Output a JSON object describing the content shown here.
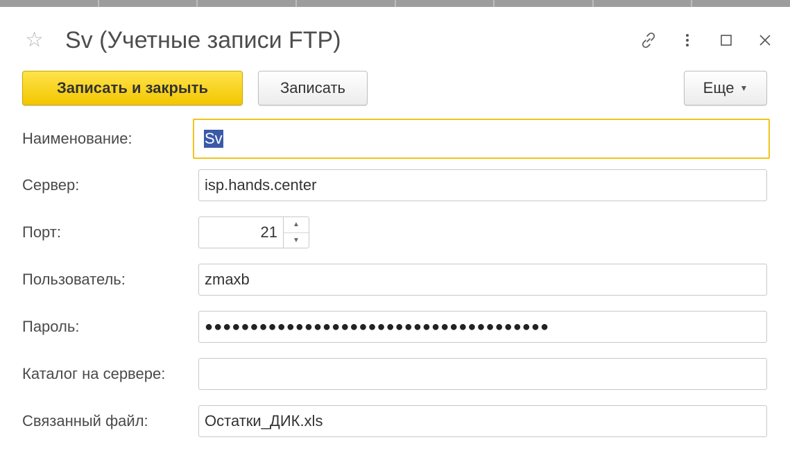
{
  "window": {
    "title": "Sv (Учетные записи FTP)",
    "icons": [
      "star-icon",
      "link-icon",
      "more-vert-icon",
      "maximize-icon",
      "close-icon"
    ]
  },
  "toolbar": {
    "save_close_label": "Записать и закрыть",
    "save_label": "Записать",
    "more_label": "Еще"
  },
  "form": {
    "name": {
      "label": "Наименование:",
      "value": "Sv"
    },
    "server": {
      "label": "Сервер:",
      "value": "isp.hands.center"
    },
    "port": {
      "label": "Порт:",
      "value": "21"
    },
    "user": {
      "label": "Пользователь:",
      "value": "zmaxb"
    },
    "password": {
      "label": "Пароль:",
      "value": "●●●●●●●●●●●●●●●●●●●●●●●●●●●●●●●●●●●●●●"
    },
    "directory": {
      "label": "Каталог на сервере:",
      "value": ""
    },
    "file": {
      "label": "Связанный файл:",
      "value": "Остатки_ДИК.xls"
    }
  },
  "colors": {
    "accent_yellow": "#f2c600",
    "focus_border": "#f0c419",
    "selection": "#3a5aa7"
  }
}
